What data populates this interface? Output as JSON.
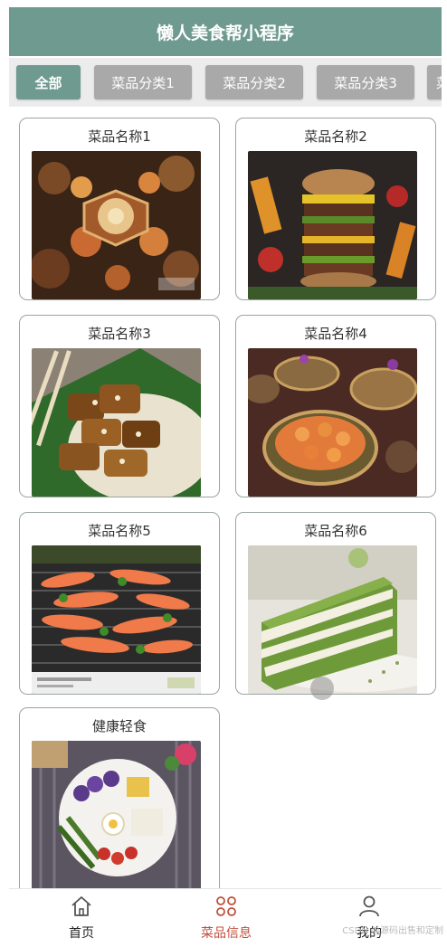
{
  "header": {
    "title": "懒人美食帮小程序"
  },
  "tabs": [
    "全部",
    "菜品分类1",
    "菜品分类2",
    "菜品分类3",
    "菜"
  ],
  "cards": [
    {
      "title": "菜品名称1",
      "image": "hotpot-feast-photo"
    },
    {
      "title": "菜品名称2",
      "image": "stacked-burger-photo"
    },
    {
      "title": "菜品名称3",
      "image": "grilled-meat-leaf-photo"
    },
    {
      "title": "菜品名称4",
      "image": "seafood-platter-photo"
    },
    {
      "title": "菜品名称5",
      "image": "grilled-shrimp-photo"
    },
    {
      "title": "菜品名称6",
      "image": "matcha-cake-photo"
    },
    {
      "title": "健康轻食",
      "image": "healthy-bowl-photo"
    }
  ],
  "tabbar": {
    "home": "首页",
    "dishes": "菜品信息",
    "mine": "我的"
  },
  "watermark": "CSDN @源码出售和定制",
  "colors": {
    "accent": "#6f9a8f",
    "tab_inactive": "#a9a9a9",
    "active_tabbar": "#c0503c"
  }
}
